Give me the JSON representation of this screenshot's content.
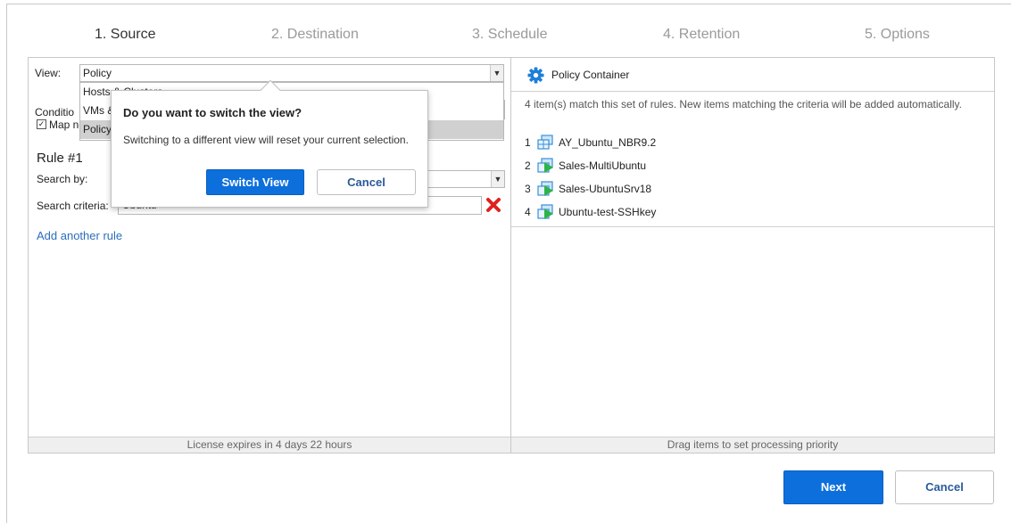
{
  "wizard": {
    "steps": [
      {
        "label": "1. Source",
        "active": true
      },
      {
        "label": "2. Destination",
        "active": false
      },
      {
        "label": "3. Schedule",
        "active": false
      },
      {
        "label": "4. Retention",
        "active": false
      },
      {
        "label": "5. Options",
        "active": false
      }
    ]
  },
  "left_panel": {
    "view_label": "View:",
    "view_value": "Policy",
    "dropdown_options": [
      "Hosts & Clusters",
      "VMs & Templates",
      "Policy"
    ],
    "dropdown_visible": [
      "Hosts & Clusters",
      "VMs &",
      "Policy"
    ],
    "conditions_label": "Conditio",
    "map_label_fragment": "Map new vi",
    "rule_title": "Rule #1",
    "search_by_label": "Search by:",
    "search_criteria_label": "Search criteria:",
    "search_criteria_value": "Ubuntu",
    "add_rule_link": "Add another rule",
    "footer": "License expires in 4 days 22 hours"
  },
  "right_panel": {
    "title": "Policy Container",
    "description": "4 item(s) match this set of rules. New items matching the criteria will be added automatically.",
    "items": [
      {
        "num": "1",
        "name": "AY_Ubuntu_NBR9.2",
        "icon": "vm-template-icon"
      },
      {
        "num": "2",
        "name": "Sales-MultiUbuntu",
        "icon": "vm-running-icon"
      },
      {
        "num": "3",
        "name": "Sales-UbuntuSrv18",
        "icon": "vm-running-icon"
      },
      {
        "num": "4",
        "name": "Ubuntu-test-SSHkey",
        "icon": "vm-running-icon"
      }
    ],
    "footer": "Drag items to set processing priority"
  },
  "popup": {
    "title": "Do you want to switch the view?",
    "message": "Switching to a different view will reset your current selection.",
    "confirm_label": "Switch View",
    "cancel_label": "Cancel"
  },
  "footer_buttons": {
    "next_label": "Next",
    "cancel_label": "Cancel"
  },
  "colors": {
    "primary": "#0d6fdc",
    "link": "#2a6ebb",
    "error": "#e02020",
    "vm_blue": "#3a8fd8",
    "vm_green": "#2db34a"
  }
}
